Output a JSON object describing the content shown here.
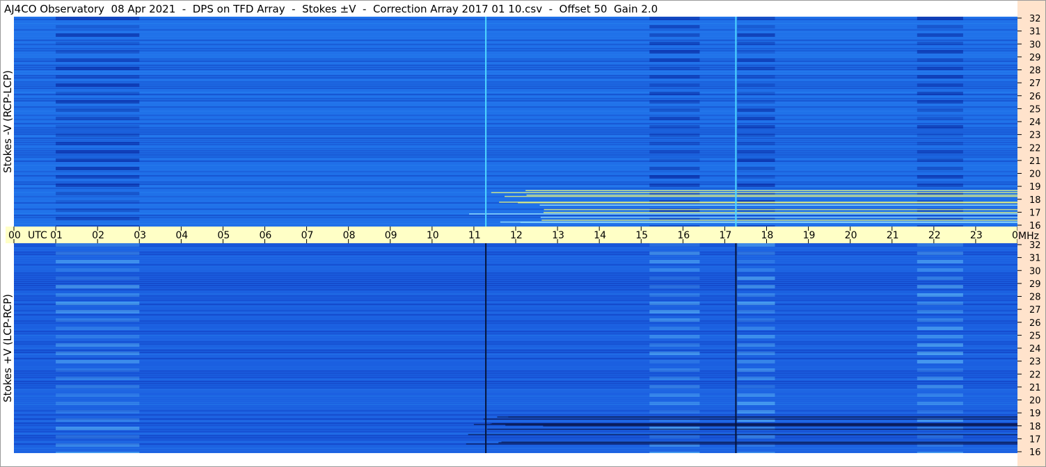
{
  "title": "AJ4CO Observatory  08 Apr 2021  -  DPS on TFD Array  -  Stokes ±V  -  Correction Array 2017 01 10.csv  -  Offset 50  Gain 2.0",
  "chart_data": {
    "type": "heatmap",
    "title": "AJ4CO Observatory  08 Apr 2021  -  DPS on TFD Array  -  Stokes ±V  -  Correction Array 2017 01 10.csv  -  Offset 50  Gain 2.0",
    "panels": [
      {
        "ylabel": "Stokes -V (RCP-LCP)",
        "base_color": "#1f6fe8"
      },
      {
        "ylabel": "Stokes +V (LCP-RCP)",
        "base_color": "#1b5fe0"
      }
    ],
    "x_ticks": [
      "00",
      "01",
      "02",
      "03",
      "04",
      "05",
      "06",
      "07",
      "08",
      "09",
      "10",
      "11",
      "12",
      "13",
      "14",
      "15",
      "16",
      "17",
      "18",
      "19",
      "20",
      "21",
      "22",
      "23",
      "00"
    ],
    "x_unit_label": "UTC",
    "x_range_hours": [
      0,
      24
    ],
    "y_ticks": [
      "32",
      "31",
      "30",
      "29",
      "28",
      "27",
      "26",
      "25",
      "24",
      "23",
      "22",
      "21",
      "20",
      "19",
      "18",
      "17",
      "16"
    ],
    "y_unit_label": "MHz",
    "y_range_mhz": [
      16,
      32
    ],
    "vertical_markers_utc": [
      11.27,
      17.25
    ],
    "colors": {
      "time_axis_bg": "#ffffc6",
      "freq_axis_bg": "#ffe3cc"
    }
  }
}
